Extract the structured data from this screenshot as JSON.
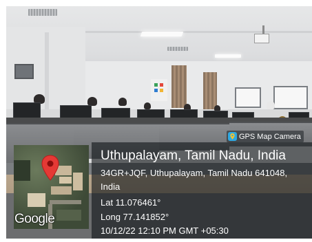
{
  "watermark": {
    "app_name": "GPS Map Camera",
    "app_icon": "gps-map-camera-icon",
    "place": "Uthupalayam, Tamil Nadu, India",
    "address_line1": "34GR+JQF, Uthupalayam, Tamil Nadu 641048,",
    "address_line2": "India",
    "latitude": "Lat 11.076461°",
    "longitude": "Long 77.141852°",
    "datetime": "10/12/22 12:10 PM GMT +05:30"
  },
  "map": {
    "brand": "Google",
    "pin_icon": "map-pin-icon",
    "pin_color": "#e53935"
  },
  "colors": {
    "panel": "#12161a",
    "pin": "#e53935",
    "badge_icon": "#2fa8e0"
  }
}
